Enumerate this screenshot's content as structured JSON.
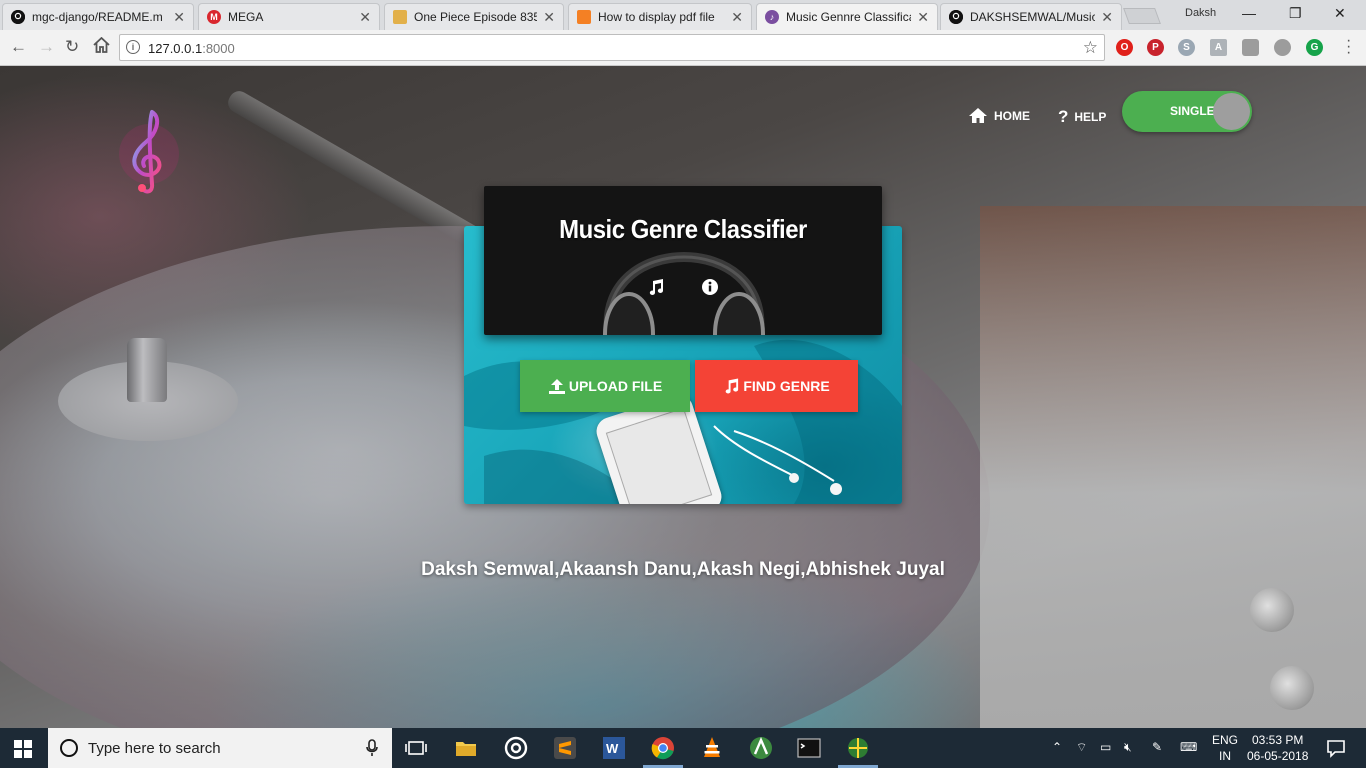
{
  "browser": {
    "tabs": [
      {
        "title": "mgc-django/README.m",
        "icon": "github-icon",
        "color": "#111111"
      },
      {
        "title": "MEGA",
        "icon": "mega-icon",
        "color": "#d9272e"
      },
      {
        "title": "One Piece Episode 835",
        "icon": "anime-site-icon",
        "color": "#c0392b"
      },
      {
        "title": "How to display pdf file",
        "icon": "stackoverflow-icon",
        "color": "#f48024"
      },
      {
        "title": "Music Gennre Classifica",
        "icon": "music-note-icon",
        "color": "#7b4fa0"
      },
      {
        "title": "DAKSHSEMWAL/Music-",
        "icon": "github-icon",
        "color": "#111111"
      }
    ],
    "active_tab_index": 4,
    "profile_name": "Daksh",
    "url_host": "127.0.0.1",
    "url_port": ":8000"
  },
  "page": {
    "nav": {
      "home_label": "HOME",
      "help_label": "HELP",
      "mode_toggle_label": "SINGLE"
    },
    "header": {
      "title": "Music Genre Classifier"
    },
    "buttons": {
      "upload_label": "UPLOAD FILE",
      "find_label": "FIND GENRE"
    },
    "authors": "Daksh Semwal,Akaansh Danu,Akash Negi,Abhishek Juyal",
    "colors": {
      "upload_green": "#4caf50",
      "find_red": "#f44336",
      "toggle_green": "#4caf50"
    }
  },
  "taskbar": {
    "search_placeholder": "Type here to search",
    "lang_top": "ENG",
    "lang_bottom": "IN",
    "time": "03:53 PM",
    "date": "06-05-2018"
  }
}
